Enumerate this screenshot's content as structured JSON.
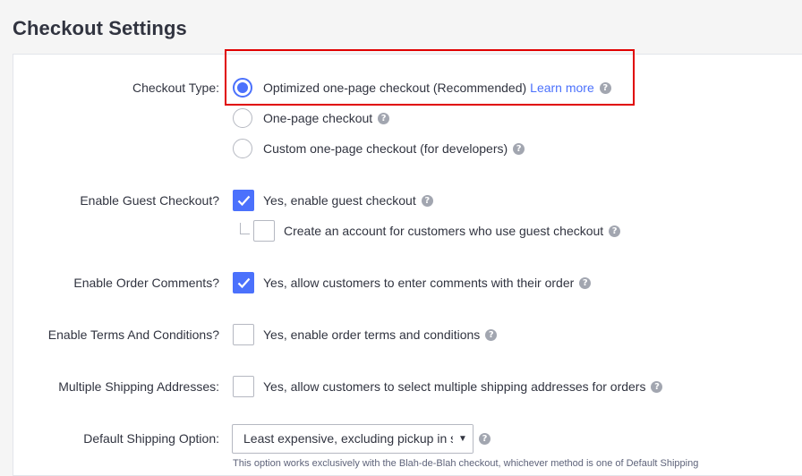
{
  "page_title": "Checkout Settings",
  "checkout_type": {
    "label": "Checkout Type:",
    "options": [
      {
        "label": "Optimized one-page checkout (Recommended)",
        "selected": true,
        "learn_more": "Learn more"
      },
      {
        "label": "One-page checkout",
        "selected": false
      },
      {
        "label": "Custom one-page checkout (for developers)",
        "selected": false
      }
    ]
  },
  "guest_checkout": {
    "label": "Enable Guest Checkout?",
    "option": "Yes, enable guest checkout",
    "checked": true,
    "sub_option": "Create an account for customers who use guest checkout",
    "sub_checked": false
  },
  "order_comments": {
    "label": "Enable Order Comments?",
    "option": "Yes, allow customers to enter comments with their order",
    "checked": true
  },
  "terms": {
    "label": "Enable Terms And Conditions?",
    "option": "Yes, enable order terms and conditions",
    "checked": false
  },
  "multi_shipping": {
    "label": "Multiple Shipping Addresses:",
    "option": "Yes, allow customers to select multiple shipping addresses for orders",
    "checked": false
  },
  "default_shipping": {
    "label": "Default Shipping Option:",
    "selected_value": "Least expensive, excluding pickup in store",
    "note": "This option works exclusively with the Blah-de-Blah checkout, whichever method is one of Default Shipping"
  },
  "colors": {
    "accent": "#4b71fc",
    "highlight": "#e00000",
    "text": "#313440"
  }
}
